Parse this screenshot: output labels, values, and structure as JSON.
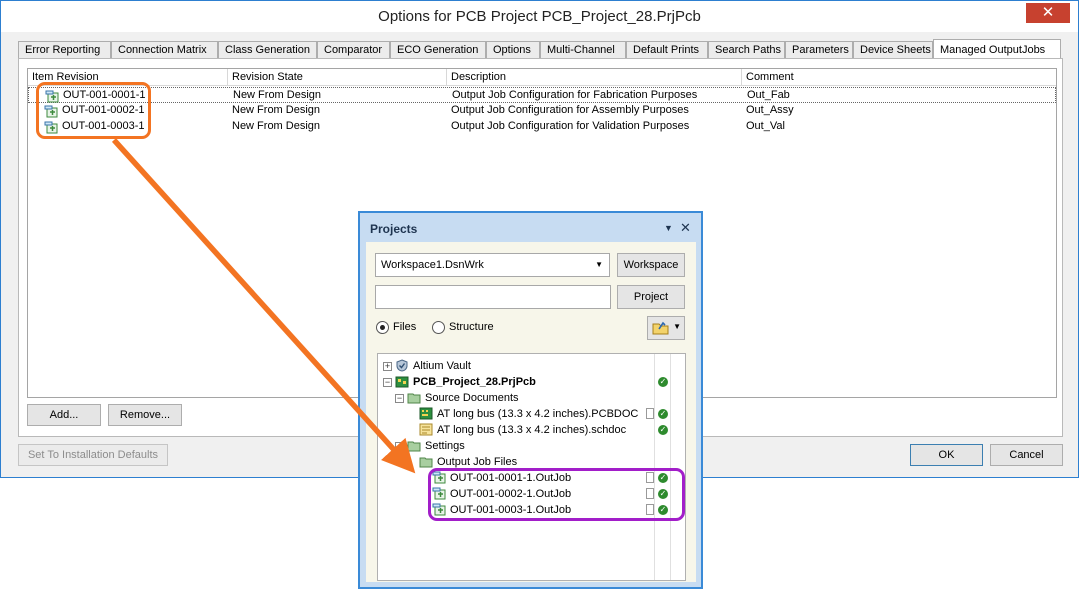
{
  "dialog": {
    "title": "Options for PCB Project PCB_Project_28.PrjPcb",
    "close_glyph": "✕",
    "tabs": [
      {
        "label": "Error Reporting"
      },
      {
        "label": "Connection Matrix"
      },
      {
        "label": "Class Generation"
      },
      {
        "label": "Comparator"
      },
      {
        "label": "ECO Generation"
      },
      {
        "label": "Options"
      },
      {
        "label": "Multi-Channel"
      },
      {
        "label": "Default Prints"
      },
      {
        "label": "Search Paths"
      },
      {
        "label": "Parameters"
      },
      {
        "label": "Device Sheets"
      },
      {
        "label": "Managed OutputJobs"
      }
    ],
    "active_tab": "Managed OutputJobs",
    "grid": {
      "columns": [
        "Item Revision",
        "Revision State",
        "Description",
        "Comment"
      ],
      "rows": [
        {
          "item": "OUT-001-0001-1",
          "state": "New From Design",
          "description": "Output Job Configuration for Fabrication Purposes",
          "comment": "Out_Fab"
        },
        {
          "item": "OUT-001-0002-1",
          "state": "New From Design",
          "description": "Output Job Configuration for Assembly Purposes",
          "comment": "Out_Assy"
        },
        {
          "item": "OUT-001-0003-1",
          "state": "New From Design",
          "description": "Output Job Configuration for Validation Purposes",
          "comment": "Out_Val"
        }
      ]
    },
    "buttons": {
      "add": "Add...",
      "remove": "Remove...",
      "defaults": "Set To Installation Defaults",
      "ok": "OK",
      "cancel": "Cancel"
    }
  },
  "projects_panel": {
    "title": "Projects",
    "menu_glyph": "▼",
    "close_glyph": "✕",
    "workspace_combo": "Workspace1.DsnWrk",
    "combo_arrow": "▼",
    "workspace_button": "Workspace",
    "project_input_value": "",
    "project_button": "Project",
    "view_options": [
      {
        "label": "Files",
        "selected": true
      },
      {
        "label": "Structure",
        "selected": false
      }
    ],
    "tree": [
      {
        "label": "Altium Vault",
        "expander": "+",
        "icon": "vault-icon",
        "bold": false,
        "check": false,
        "doc": false
      },
      {
        "label": "PCB_Project_28.PrjPcb",
        "expander": "−",
        "icon": "pcb-project-icon",
        "bold": true,
        "check": true,
        "doc": false
      },
      {
        "label": "Source Documents",
        "expander": "−",
        "icon": "folder-icon",
        "bold": false,
        "check": false,
        "doc": false
      },
      {
        "label": "AT long bus (13.3 x 4.2 inches).PCBDOC",
        "expander": "",
        "icon": "pcb-document-icon",
        "bold": false,
        "check": true,
        "doc": true
      },
      {
        "label": "AT long bus (13.3 x 4.2 inches).schdoc",
        "expander": "",
        "icon": "schematic-document-icon",
        "bold": false,
        "check": true,
        "doc": false
      },
      {
        "label": "Settings",
        "expander": "−",
        "icon": "folder-icon",
        "bold": false,
        "check": false,
        "doc": false
      },
      {
        "label": "Output Job Files",
        "expander": "",
        "icon": "folder-icon",
        "bold": false,
        "check": false,
        "doc": false
      },
      {
        "label": "OUT-001-0001-1.OutJob",
        "expander": "",
        "icon": "outjob-icon",
        "bold": false,
        "check": true,
        "doc": true
      },
      {
        "label": "OUT-001-0002-1.OutJob",
        "expander": "",
        "icon": "outjob-icon",
        "bold": false,
        "check": true,
        "doc": true
      },
      {
        "label": "OUT-001-0003-1.OutJob",
        "expander": "",
        "icon": "outjob-icon",
        "bold": false,
        "check": true,
        "doc": true
      }
    ],
    "check_glyph": "✓"
  },
  "colors": {
    "highlight_orange": "#f37422",
    "highlight_purple": "#a21ec9",
    "panel_border": "#3a8ad7",
    "check_green": "#2e8b2e"
  }
}
